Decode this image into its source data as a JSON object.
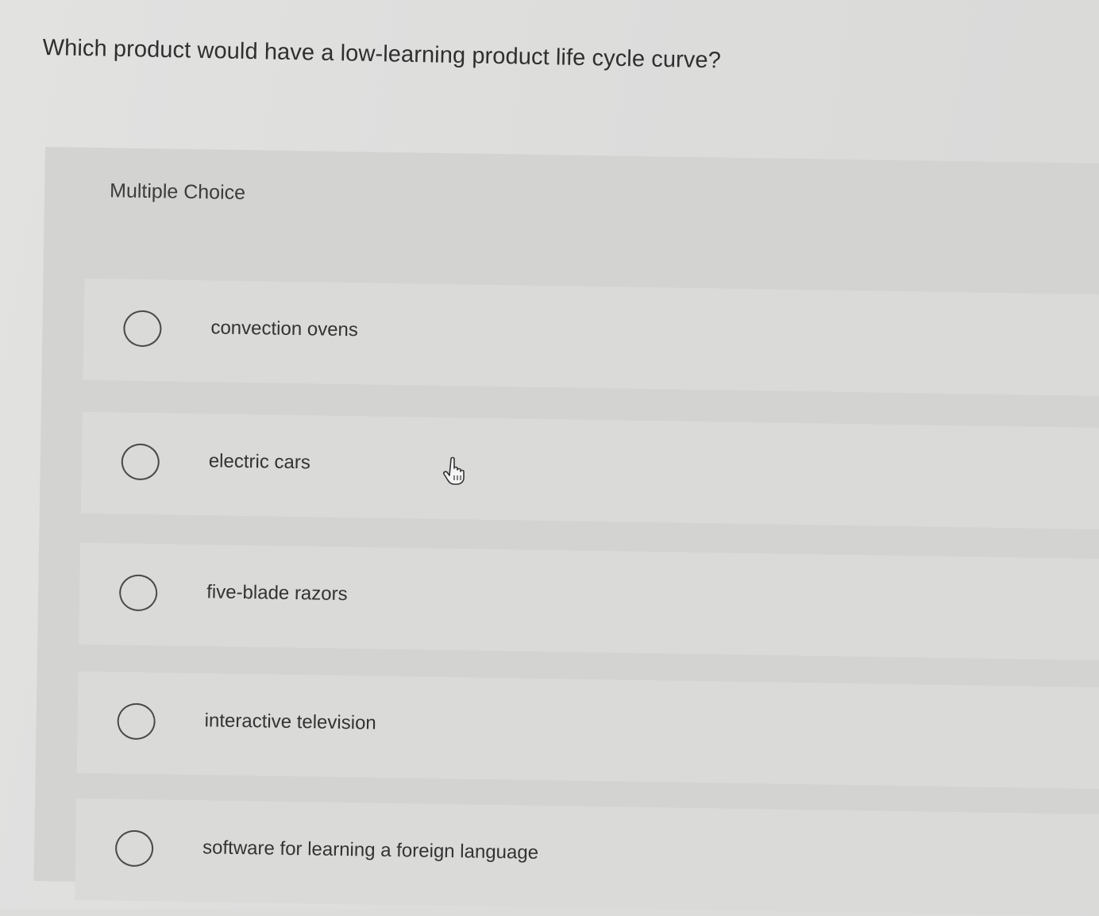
{
  "question": {
    "text": "Which product would have a low-learning product life cycle curve?"
  },
  "choices": {
    "label": "Multiple Choice",
    "options": [
      {
        "label": "convection ovens",
        "selected": false
      },
      {
        "label": "electric cars",
        "selected": false
      },
      {
        "label": "five-blade razors",
        "selected": false
      },
      {
        "label": "interactive television",
        "selected": false
      },
      {
        "label": "software for learning a foreign language",
        "selected": false
      }
    ]
  },
  "cursor": {
    "icon": "hand-pointer-icon"
  },
  "colors": {
    "background": "#dcdcdb",
    "panel": "#d3d3d2",
    "option_row": "#dadad9",
    "text": "#333333",
    "radio_border": "#4a4a4a"
  }
}
